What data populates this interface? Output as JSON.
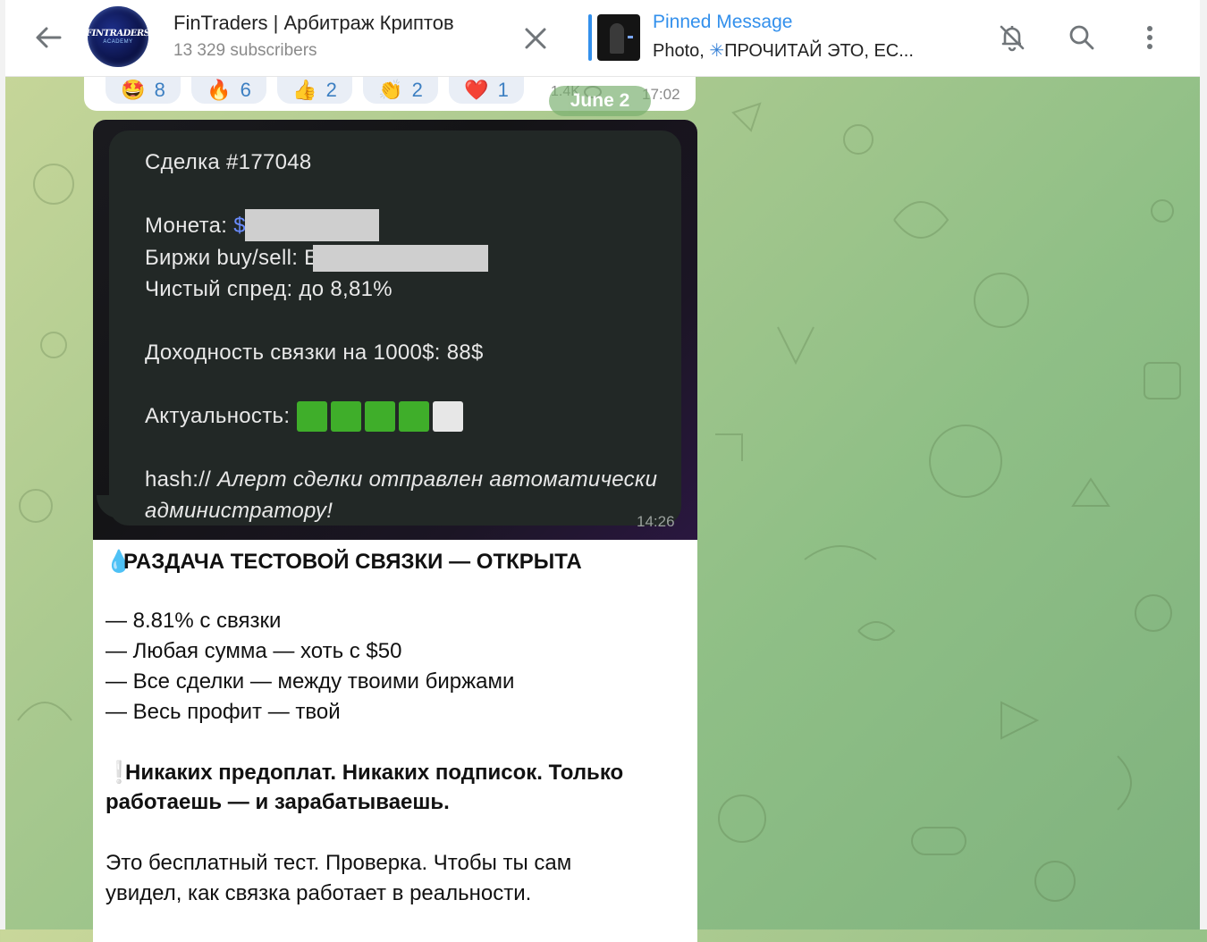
{
  "header": {
    "channel_title": "FinTraders | Арбитраж Криптов",
    "subscribers": "13 329 subscribers",
    "avatar_text_line1": "FINTRADERS",
    "avatar_text_line2": "ACADEMY",
    "pinned_title": "Pinned Message",
    "pinned_text_prefix": "Photo,",
    "pinned_text_star": "✳",
    "pinned_text": "ПРОЧИТАЙ ЭТО, ЕС..."
  },
  "prev_message": {
    "reactions": [
      {
        "emoji": "🤩",
        "count": "8"
      },
      {
        "emoji": "🔥",
        "count": "6"
      },
      {
        "emoji": "👍",
        "count": "2"
      },
      {
        "emoji": "👏",
        "count": "2"
      },
      {
        "emoji": "❤️",
        "count": "1"
      }
    ],
    "views": "1.4K",
    "time": "17:02"
  },
  "date_separator": "June 2",
  "photo_message": {
    "deal_title": "Сделка #177048",
    "coin_label": "Монета:",
    "coin_value_visible": "$N",
    "exchanges_label": "Биржи buy/sell:",
    "exchanges_value_visible": "E",
    "spread": "Чистый спред: до 8,81%",
    "profit": "Доходность связки на 1000$: 88$",
    "relevance_label": "Актуальность:",
    "relevance_level": "4/5",
    "hash_prefix": "hash://",
    "hash_text_line1": "Алерт сделки отправлен автоматически",
    "hash_text_line2": "администратору!",
    "time": "14:26"
  },
  "caption": {
    "fire_emoji": "💧",
    "headline": "РАЗДАЧА ТЕСТОВОЙ СВЯЗКИ — ОТКРЫТА",
    "bullets": [
      "— 8.81% с связки",
      "— Любая сумма — хоть с $50",
      "— Все сделки — между твоими биржами",
      "— Весь профит — твой"
    ],
    "excl_emoji": "❕",
    "notice_line1": "Никаких предоплат. Никаких подписок. Только",
    "notice_line2": "работаешь — и зарабатываешь.",
    "para_line1": "Это бесплатный тест. Проверка. Чтобы ты сам",
    "para_line2": "увидел, как связка работает в реальности."
  }
}
